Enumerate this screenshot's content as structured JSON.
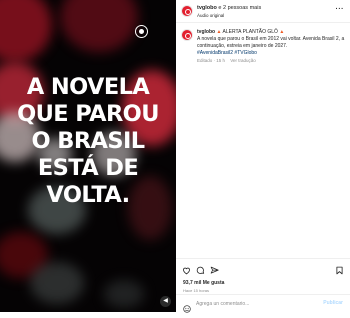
{
  "video": {
    "headline_lines": [
      "A NOVELA",
      "QUE PAROU",
      "O BRASIL",
      "ESTÁ DE",
      "VOLTA."
    ],
    "logo_icon": "globo-logo-icon",
    "mute_icon": "volume-icon"
  },
  "header": {
    "username": "tvglobo",
    "with_text": "e 2 pessoas mais",
    "subtitle": "Áudio original",
    "more_icon": "more-horizontal-icon"
  },
  "caption": {
    "username": "tvglobo",
    "alert": "ALERTA PLANTÃO GLÔ",
    "body": "A novela que parou o Brasil em 2012 vai voltar. Avenida Brasil 2, a continuação, estreia em janeiro de 2027.",
    "hashtags": "#AvenidaBrasil2 #TVGlobo",
    "edited": "Editado · 15 h",
    "translate": "Ver tradução"
  },
  "actions": {
    "likes": "93,7 mil Me gusta",
    "time": "Hace 15 horas",
    "icons": [
      "heart-icon",
      "comment-icon",
      "share-icon",
      "save-icon"
    ]
  },
  "comment": {
    "placeholder": "Agrega un comentario...",
    "publish": "Publicar"
  },
  "colors": {
    "brand_red": "#e3202f",
    "link_blue": "#00376b",
    "publish_disabled": "#b3dbff"
  }
}
